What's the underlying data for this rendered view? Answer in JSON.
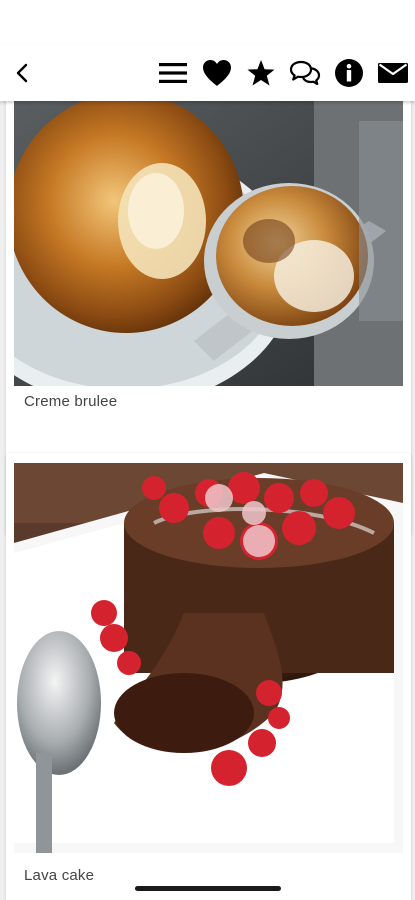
{
  "toolbar": {
    "icons": [
      "chevron-left-icon",
      "menu-icon",
      "heart-icon",
      "star-icon",
      "chat-icon",
      "info-icon",
      "mail-icon"
    ]
  },
  "recipes": [
    {
      "name": "Creme brulee"
    },
    {
      "name": "Lava cake"
    }
  ],
  "colors": {
    "background": "#efefef",
    "card": "#ffffff",
    "icon": "#000000",
    "caption": "#444444"
  }
}
